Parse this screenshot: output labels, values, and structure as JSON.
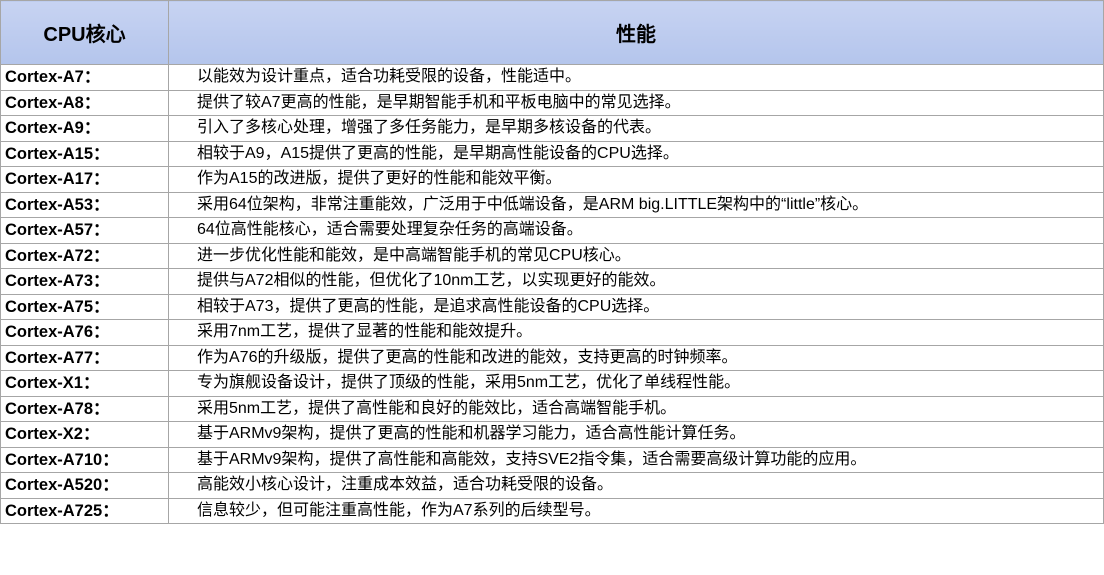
{
  "table": {
    "headers": [
      "CPU核心",
      "性能"
    ],
    "rows": [
      {
        "core": "Cortex-A7：",
        "perf": "以能效为设计重点，适合功耗受限的设备，性能适中。"
      },
      {
        "core": "Cortex-A8：",
        "perf": "提供了较A7更高的性能，是早期智能手机和平板电脑中的常见选择。"
      },
      {
        "core": "Cortex-A9：",
        "perf": "引入了多核心处理，增强了多任务能力，是早期多核设备的代表。"
      },
      {
        "core": "Cortex-A15：",
        "perf": "相较于A9，A15提供了更高的性能，是早期高性能设备的CPU选择。"
      },
      {
        "core": "Cortex-A17：",
        "perf": "作为A15的改进版，提供了更好的性能和能效平衡。"
      },
      {
        "core": "Cortex-A53：",
        "perf": "采用64位架构，非常注重能效，广泛用于中低端设备，是ARM big.LITTLE架构中的“little”核心。"
      },
      {
        "core": "Cortex-A57：",
        "perf": "64位高性能核心，适合需要处理复杂任务的高端设备。"
      },
      {
        "core": "Cortex-A72：",
        "perf": "进一步优化性能和能效，是中高端智能手机的常见CPU核心。"
      },
      {
        "core": "Cortex-A73：",
        "perf": "提供与A72相似的性能，但优化了10nm工艺，以实现更好的能效。"
      },
      {
        "core": "Cortex-A75：",
        "perf": "相较于A73，提供了更高的性能，是追求高性能设备的CPU选择。"
      },
      {
        "core": "Cortex-A76：",
        "perf": "采用7nm工艺，提供了显著的性能和能效提升。"
      },
      {
        "core": "Cortex-A77：",
        "perf": "作为A76的升级版，提供了更高的性能和改进的能效，支持更高的时钟频率。"
      },
      {
        "core": "Cortex-X1：",
        "perf": "专为旗舰设备设计，提供了顶级的性能，采用5nm工艺，优化了单线程性能。"
      },
      {
        "core": "Cortex-A78：",
        "perf": "采用5nm工艺，提供了高性能和良好的能效比，适合高端智能手机。"
      },
      {
        "core": "Cortex-X2：",
        "perf": "基于ARMv9架构，提供了更高的性能和机器学习能力，适合高性能计算任务。"
      },
      {
        "core": "Cortex-A710：",
        "perf": "基于ARMv9架构，提供了高性能和高能效，支持SVE2指令集，适合需要高级计算功能的应用。"
      },
      {
        "core": "Cortex-A520：",
        "perf": "高能效小核心设计，注重成本效益，适合功耗受限的设备。"
      },
      {
        "core": "Cortex-A725：",
        "perf": "信息较少，但可能注重高性能，作为A7系列的后续型号。"
      }
    ]
  },
  "colors": {
    "header_background": "#b9c9ee",
    "border": "#a6a6a6",
    "text": "#000000"
  }
}
